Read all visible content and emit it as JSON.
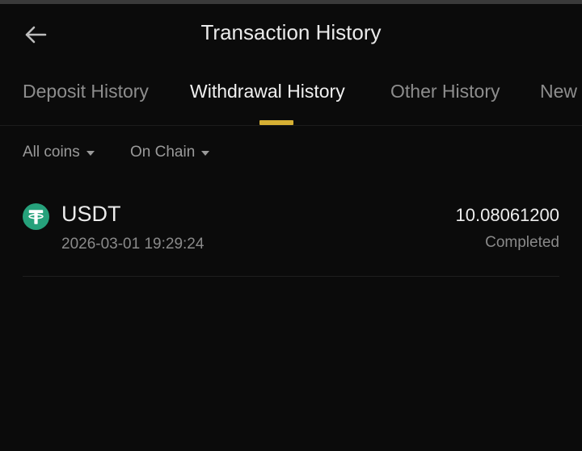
{
  "header": {
    "back_icon": "arrow-left-icon",
    "title": "Transaction History"
  },
  "tabs": [
    {
      "label": "Deposit History",
      "active": false
    },
    {
      "label": "Withdrawal History",
      "active": true
    },
    {
      "label": "Other History",
      "active": false
    },
    {
      "label": "New",
      "active": false
    }
  ],
  "filters": {
    "coins": "All coins",
    "method": "On Chain"
  },
  "transactions": [
    {
      "coin": "USDT",
      "coin_icon": "tether-icon",
      "time": "2026-03-01 19:29:24",
      "amount": "10.08061200",
      "status": "Completed"
    }
  ],
  "colors": {
    "background": "#0b0b0b",
    "accent": "#d6b034",
    "tether_green": "#26a17b",
    "text_primary": "#ececec",
    "text_secondary": "#8a8a8a"
  }
}
